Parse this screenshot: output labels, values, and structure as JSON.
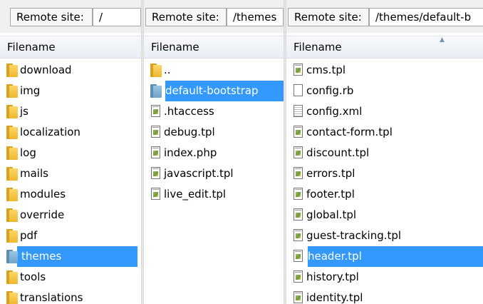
{
  "panels": [
    {
      "remote_label": "Remote site:",
      "remote_path": "/",
      "column_header": "Filename",
      "items": [
        {
          "name": "download",
          "icon": "folder-icon",
          "selected": false
        },
        {
          "name": "img",
          "icon": "folder-icon",
          "selected": false
        },
        {
          "name": "js",
          "icon": "folder-icon",
          "selected": false
        },
        {
          "name": "localization",
          "icon": "folder-icon",
          "selected": false
        },
        {
          "name": "log",
          "icon": "folder-icon",
          "selected": false
        },
        {
          "name": "mails",
          "icon": "folder-icon",
          "selected": false
        },
        {
          "name": "modules",
          "icon": "folder-icon",
          "selected": false
        },
        {
          "name": "override",
          "icon": "folder-icon",
          "selected": false
        },
        {
          "name": "pdf",
          "icon": "folder-icon",
          "selected": false
        },
        {
          "name": "themes",
          "icon": "folder-open-icon",
          "selected": true
        },
        {
          "name": "tools",
          "icon": "folder-icon",
          "selected": false
        },
        {
          "name": "translations",
          "icon": "folder-icon",
          "selected": false
        }
      ]
    },
    {
      "remote_label": "Remote site:",
      "remote_path": "/themes",
      "column_header": "Filename",
      "items": [
        {
          "name": "..",
          "icon": "folder-icon",
          "selected": false
        },
        {
          "name": "default-bootstrap",
          "icon": "folder-open-icon",
          "selected": true
        },
        {
          "name": ".htaccess",
          "icon": "template-file-icon",
          "selected": false
        },
        {
          "name": "debug.tpl",
          "icon": "template-file-icon",
          "selected": false
        },
        {
          "name": "index.php",
          "icon": "template-file-icon",
          "selected": false
        },
        {
          "name": "javascript.tpl",
          "icon": "template-file-icon",
          "selected": false
        },
        {
          "name": "live_edit.tpl",
          "icon": "template-file-icon",
          "selected": false
        }
      ]
    },
    {
      "remote_label": "Remote site:",
      "remote_path": "/themes/default-b",
      "column_header": "Filename",
      "items": [
        {
          "name": "cms.tpl",
          "icon": "template-file-icon",
          "selected": false
        },
        {
          "name": "config.rb",
          "icon": "blank-file-icon",
          "selected": false
        },
        {
          "name": "config.xml",
          "icon": "text-file-icon",
          "selected": false
        },
        {
          "name": "contact-form.tpl",
          "icon": "template-file-icon",
          "selected": false
        },
        {
          "name": "discount.tpl",
          "icon": "template-file-icon",
          "selected": false
        },
        {
          "name": "errors.tpl",
          "icon": "template-file-icon",
          "selected": false
        },
        {
          "name": "footer.tpl",
          "icon": "template-file-icon",
          "selected": false
        },
        {
          "name": "global.tpl",
          "icon": "template-file-icon",
          "selected": false
        },
        {
          "name": "guest-tracking.tpl",
          "icon": "template-file-icon",
          "selected": false
        },
        {
          "name": "header.tpl",
          "icon": "template-file-icon",
          "selected": true
        },
        {
          "name": "history.tpl",
          "icon": "template-file-icon",
          "selected": false
        },
        {
          "name": "identity.tpl",
          "icon": "template-file-icon",
          "selected": false
        }
      ]
    }
  ],
  "colors": {
    "selection": "#3399ff",
    "folder": "#f0b72c",
    "folder_open": "#6fa3ca"
  }
}
